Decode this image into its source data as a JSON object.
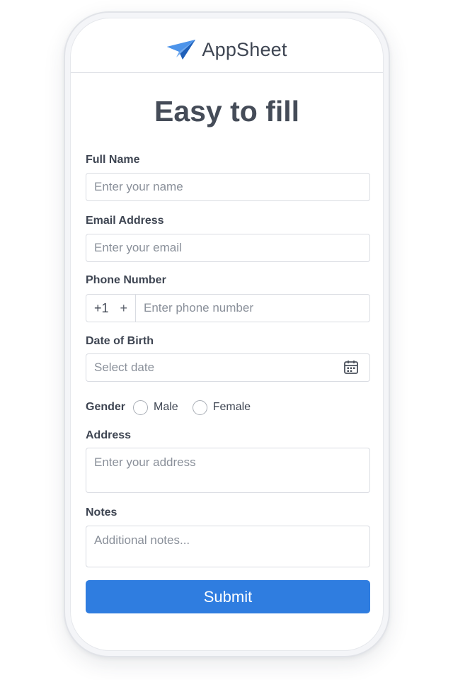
{
  "header": {
    "brand": "AppSheet",
    "logo_icon": "paper-plane-icon",
    "logo_color": "#2f7de0"
  },
  "title": "Easy to fill",
  "form": {
    "full_name": {
      "label": "Full Name",
      "placeholder": "Enter your name"
    },
    "email": {
      "label": "Email Address",
      "placeholder": "Enter your email"
    },
    "phone": {
      "label": "Phone Number",
      "country_code": "+1",
      "country_toggle": "+",
      "placeholder": "Enter phone number"
    },
    "dob": {
      "label": "Date of Birth",
      "placeholder": "Select date",
      "icon": "calendar-icon"
    },
    "gender": {
      "label": "Gender",
      "options": [
        "Male",
        "Female"
      ]
    },
    "address": {
      "label": "Address",
      "placeholder": "Enter your address"
    },
    "notes": {
      "label": "Notes",
      "placeholder": "Additional notes..."
    },
    "submit_label": "Submit"
  },
  "colors": {
    "accent": "#2f7de0",
    "text": "#3e4552",
    "placeholder": "#8a909a",
    "border": "#d9dce2"
  }
}
